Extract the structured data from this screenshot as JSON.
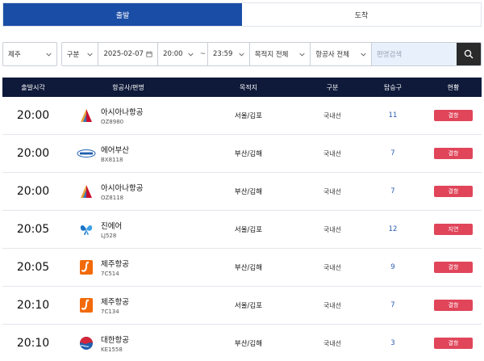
{
  "tabs": {
    "departure": "출발",
    "arrival": "도착"
  },
  "filters": {
    "airport": "제주",
    "category": "구분",
    "date": "2025-02-07",
    "time_from": "20:00",
    "time_sep": "~",
    "time_to": "23:59",
    "destination": "목적지 전체",
    "airline": "항공사 전체",
    "flight_placeholder": "편명검색"
  },
  "table": {
    "headers": {
      "time": "출발시각",
      "airline": "항공사/편명",
      "destination": "목적지",
      "type": "구분",
      "gate": "탑승구",
      "status": "현황"
    }
  },
  "flights": [
    {
      "time": "20:00",
      "airline": "아시아나항공",
      "flight": "OZ8980",
      "destination": "서울/김포",
      "type": "국내선",
      "gate": "11",
      "status": "결항",
      "logo_icon": "asiana-logo-icon"
    },
    {
      "time": "20:00",
      "airline": "에어부산",
      "flight": "BX8118",
      "destination": "부산/김해",
      "type": "국내선",
      "gate": "7",
      "status": "결항",
      "logo_icon": "airbusan-logo-icon"
    },
    {
      "time": "20:00",
      "airline": "아시아나항공",
      "flight": "OZ8118",
      "destination": "부산/김해",
      "type": "국내선",
      "gate": "7",
      "status": "결항",
      "logo_icon": "asiana-logo-icon"
    },
    {
      "time": "20:05",
      "airline": "진에어",
      "flight": "LJ528",
      "destination": "서울/김포",
      "type": "국내선",
      "gate": "12",
      "status": "지연",
      "logo_icon": "jinair-logo-icon"
    },
    {
      "time": "20:05",
      "airline": "제주항공",
      "flight": "7C514",
      "destination": "부산/김해",
      "type": "국내선",
      "gate": "9",
      "status": "결항",
      "logo_icon": "jejuair-logo-icon"
    },
    {
      "time": "20:10",
      "airline": "제주항공",
      "flight": "7C134",
      "destination": "서울/김포",
      "type": "국내선",
      "gate": "7",
      "status": "결항",
      "logo_icon": "jejuair-logo-icon"
    },
    {
      "time": "20:10",
      "airline": "대한항공",
      "flight": "KE1558",
      "destination": "부산/김해",
      "type": "국내선",
      "gate": "3",
      "status": "결항",
      "logo_icon": "koreanair-logo-icon"
    }
  ],
  "colors": {
    "accent": "#1a4da6",
    "header_bg": "#0f1a3a",
    "status_badge": "#e0455a",
    "gate_text": "#2a5db0"
  }
}
